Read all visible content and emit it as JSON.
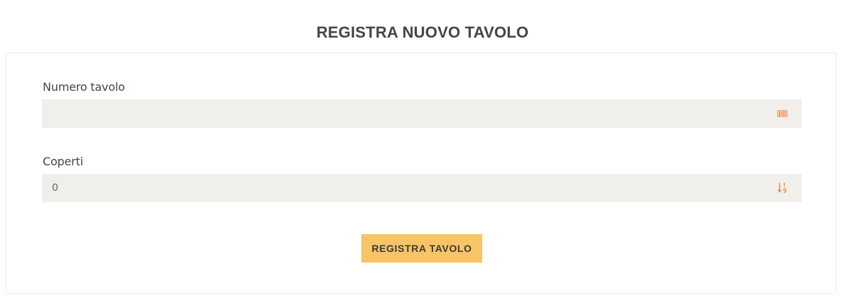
{
  "page": {
    "title": "REGISTRA NUOVO TAVOLO"
  },
  "form": {
    "numero_tavolo": {
      "label": "Numero tavolo",
      "value": "",
      "icon": "barcode-icon"
    },
    "coperti": {
      "label": "Coperti",
      "value": "0",
      "icon": "sort-numeric-icon"
    },
    "submit_label": "REGISTRA TAVOLO"
  },
  "colors": {
    "accent": "#f8c468",
    "icon": "#f0834a",
    "field_background": "#f1efeb",
    "text": "#4a443e"
  }
}
